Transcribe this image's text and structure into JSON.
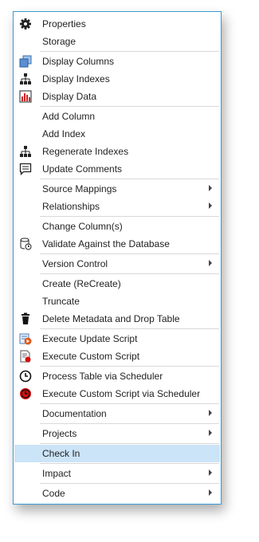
{
  "menu": {
    "items": [
      {
        "label": "Properties",
        "icon": "gear-icon"
      },
      {
        "label": "Storage"
      },
      {
        "label": "Display Columns",
        "icon": "display-columns-icon"
      },
      {
        "label": "Display Indexes",
        "icon": "hierarchy-icon"
      },
      {
        "label": "Display Data",
        "icon": "bar-chart-icon"
      },
      {
        "label": "Add Column"
      },
      {
        "label": "Add Index"
      },
      {
        "label": "Regenerate Indexes",
        "icon": "hierarchy-icon"
      },
      {
        "label": "Update Comments",
        "icon": "comment-icon"
      },
      {
        "label": "Source Mappings",
        "submenu": true
      },
      {
        "label": "Relationships",
        "submenu": true
      },
      {
        "label": "Change Column(s)"
      },
      {
        "label": "Validate Against the Database",
        "icon": "database-check-icon"
      },
      {
        "label": "Version Control",
        "submenu": true
      },
      {
        "label": "Create (ReCreate)"
      },
      {
        "label": "Truncate"
      },
      {
        "label": "Delete Metadata and Drop Table",
        "icon": "trash-icon"
      },
      {
        "label": "Execute Update Script",
        "icon": "execute-update-script-icon"
      },
      {
        "label": "Execute Custom Script",
        "icon": "execute-custom-script-icon"
      },
      {
        "label": "Process Table via Scheduler",
        "icon": "clock-icon"
      },
      {
        "label": "Execute Custom Script via Scheduler",
        "icon": "red-clock-icon"
      },
      {
        "label": "Documentation",
        "submenu": true
      },
      {
        "label": "Projects",
        "submenu": true
      },
      {
        "label": "Check In",
        "highlighted": true
      },
      {
        "label": "Impact",
        "submenu": true
      },
      {
        "label": "Code",
        "submenu": true
      }
    ],
    "colors": {
      "highlight": "#cce4f7",
      "border": "#3b9bd6"
    }
  }
}
